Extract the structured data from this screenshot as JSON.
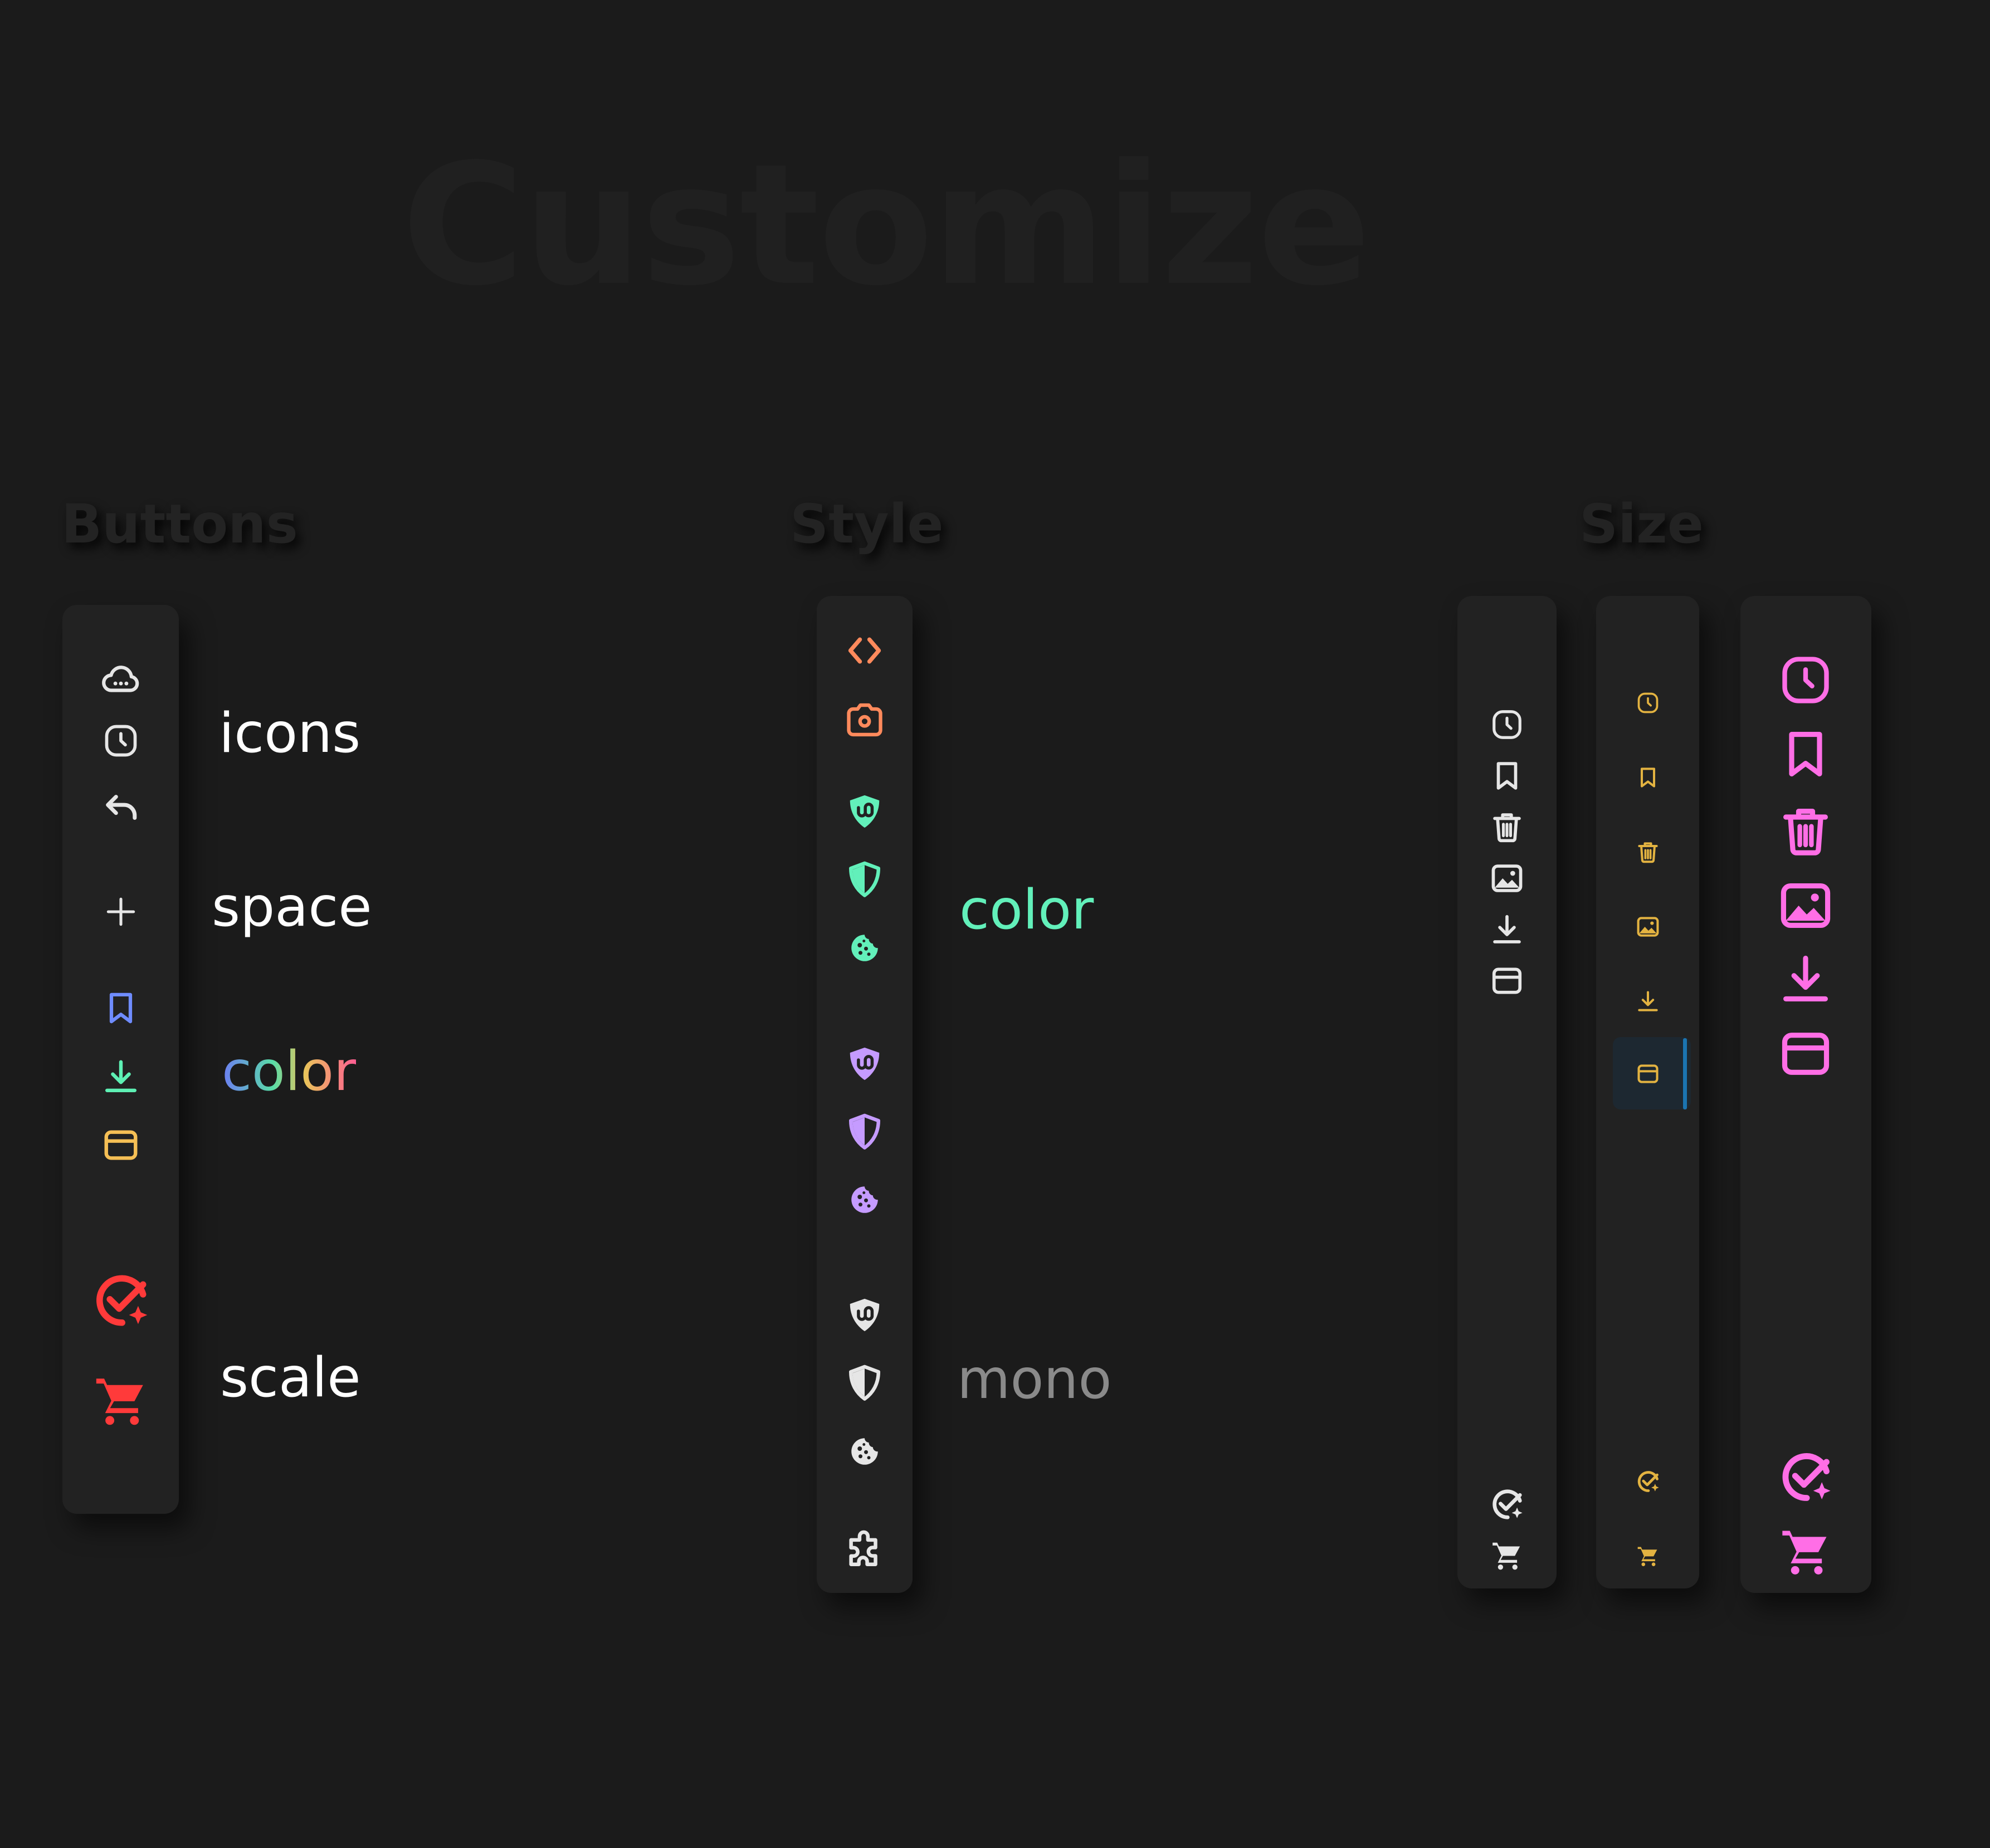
{
  "title": "Customize",
  "sections": {
    "buttons": {
      "heading": "Buttons",
      "labels": {
        "icons": "icons",
        "space": "space",
        "color": "color",
        "scale": "scale"
      },
      "icons": [
        "cloud-icon",
        "clock-icon",
        "undo-icon",
        "plus-icon",
        "bookmark-icon",
        "download-icon",
        "window-icon",
        "check-sparkle-icon",
        "cart-icon"
      ],
      "colors": {
        "default": "#e6e6e6",
        "bookmark": "#6f8cff",
        "download": "#5ef0b4",
        "window": "#f5bf55",
        "scale": "#ff3a3a"
      }
    },
    "style": {
      "heading": "Style",
      "labels": {
        "color": "color",
        "mono": "mono"
      },
      "icon_groups": [
        {
          "name": "orange",
          "color": "#ff8a5c",
          "icons": [
            "code-icon",
            "camera-icon"
          ]
        },
        {
          "name": "green",
          "color": "#62f0ba",
          "icons": [
            "ublock-shield-icon",
            "shield-icon",
            "cookie-icon"
          ]
        },
        {
          "name": "purple",
          "color": "#c59bff",
          "icons": [
            "ublock-shield-icon",
            "shield-icon",
            "cookie-icon"
          ]
        },
        {
          "name": "mono",
          "color": "#e6e6e6",
          "icons": [
            "ublock-shield-icon",
            "shield-icon",
            "cookie-icon",
            "puzzle-icon"
          ]
        }
      ]
    },
    "size": {
      "heading": "Size",
      "panels": [
        {
          "name": "small",
          "color": "#e6e6e6",
          "icons": [
            "clock-icon",
            "bookmark-icon",
            "trash-icon",
            "image-icon",
            "download-icon",
            "window-icon",
            "check-sparkle-icon",
            "cart-icon"
          ]
        },
        {
          "name": "compact",
          "color": "#e3b341",
          "selected": "window-icon",
          "accent": "#1b74b0",
          "icons": [
            "clock-icon",
            "bookmark-icon",
            "trash-icon",
            "image-icon",
            "download-icon",
            "window-icon",
            "check-sparkle-icon",
            "cart-icon"
          ]
        },
        {
          "name": "large",
          "color": "#ff6ee6",
          "icons": [
            "clock-icon",
            "bookmark-icon",
            "trash-icon",
            "image-icon",
            "download-icon",
            "window-icon",
            "check-sparkle-icon",
            "cart-icon"
          ]
        }
      ]
    }
  }
}
